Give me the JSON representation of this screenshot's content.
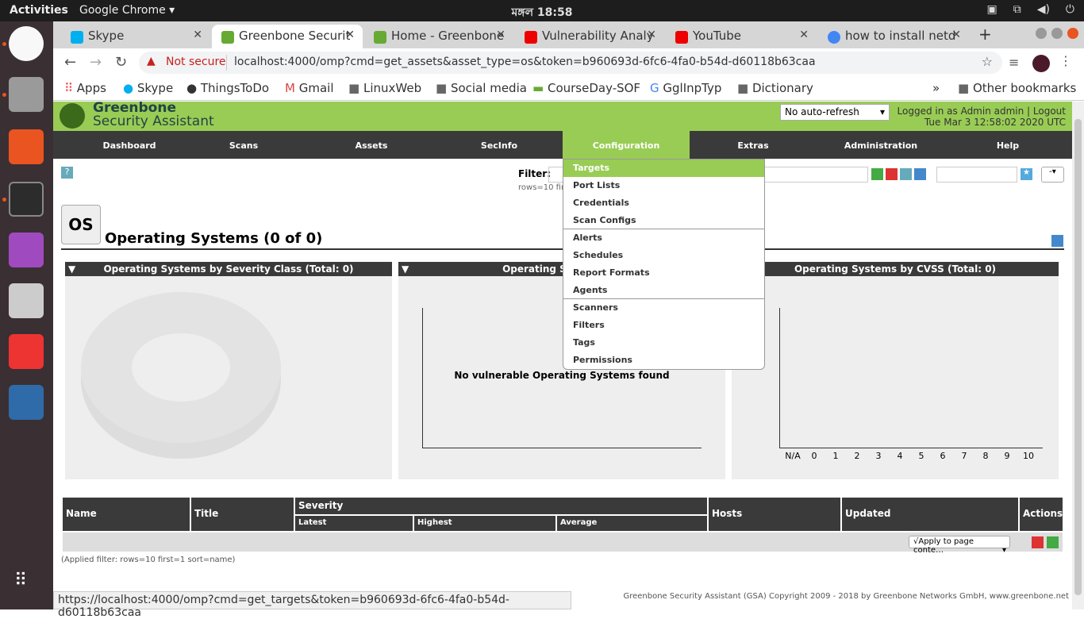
{
  "os": {
    "activities": "Activities",
    "app_name": "Google Chrome ▾",
    "clock": "মঙ্গল 18:58"
  },
  "tabs": [
    {
      "label": "Skype",
      "color": "#00aff0"
    },
    {
      "label": "Greenbone Securit",
      "color": "#6a3"
    },
    {
      "label": "Home - Greenbone",
      "color": "#6a3"
    },
    {
      "label": "Vulnerability Analy",
      "color": "#e00"
    },
    {
      "label": "YouTube",
      "color": "#e00"
    },
    {
      "label": "how to install netd",
      "color": "#4285f4"
    }
  ],
  "address": {
    "not_secure": "Not secure",
    "url": "localhost:4000/omp?cmd=get_assets&asset_type=os&token=b960693d-6fc6-4fa0-b54d-d60118b63caa"
  },
  "bookmarks": [
    "Apps",
    "Skype",
    "ThingsToDo",
    "Gmail",
    "LinuxWeb",
    "Social media",
    "CourseDay-SOF",
    "GglInpTyp",
    "Dictionary"
  ],
  "other_bookmarks": "Other bookmarks",
  "gsa": {
    "brand1": "Greenbone",
    "brand2": "Security Assistant",
    "refresh": "No auto-refresh",
    "logged": "Logged in as  Admin  admin |  Logout",
    "date": "Tue Mar 3 12:58:02 2020 UTC",
    "nav": [
      "Dashboard",
      "Scans",
      "Assets",
      "SecInfo",
      "Configuration",
      "Extras",
      "Administration",
      "Help"
    ],
    "filter_label": "Filter:",
    "filter_note": "rows=10 first",
    "page_icon": "OS",
    "page_title": "Operating Systems (0 of 0)",
    "widget1": "Operating Systems by Severity Class (Total: 0)",
    "widget2": "Operating Systems by",
    "widget3": "Operating Systems by CVSS (Total: 0)",
    "no_vuln": "No vulnerable Operating Systems found",
    "cvss_ticks": [
      "N/A",
      "0",
      "1",
      "2",
      "3",
      "4",
      "5",
      "6",
      "7",
      "8",
      "9",
      "10"
    ],
    "menu": [
      [
        "Targets",
        "Port Lists",
        "Credentials",
        "Scan Configs"
      ],
      [
        "Alerts",
        "Schedules",
        "Report Formats",
        "Agents"
      ],
      [
        "Scanners",
        "Filters",
        "Tags",
        "Permissions"
      ]
    ],
    "cols": {
      "name": "Name",
      "title": "Title",
      "severity": "Severity",
      "latest": "Latest",
      "highest": "Highest",
      "average": "Average",
      "hosts": "Hosts",
      "updated": "Updated",
      "actions": "Actions"
    },
    "apply": "√Apply to page conte…",
    "applied": "(Applied filter: rows=10 first=1 sort=name)",
    "footer": "Greenbone Security Assistant (GSA) Copyright 2009 - 2018 by Greenbone Networks GmbH, www.greenbone.net"
  },
  "status_url": "https://localhost:4000/omp?cmd=get_targets&token=b960693d-6fc6-4fa0-b54d-d60118b63caa"
}
